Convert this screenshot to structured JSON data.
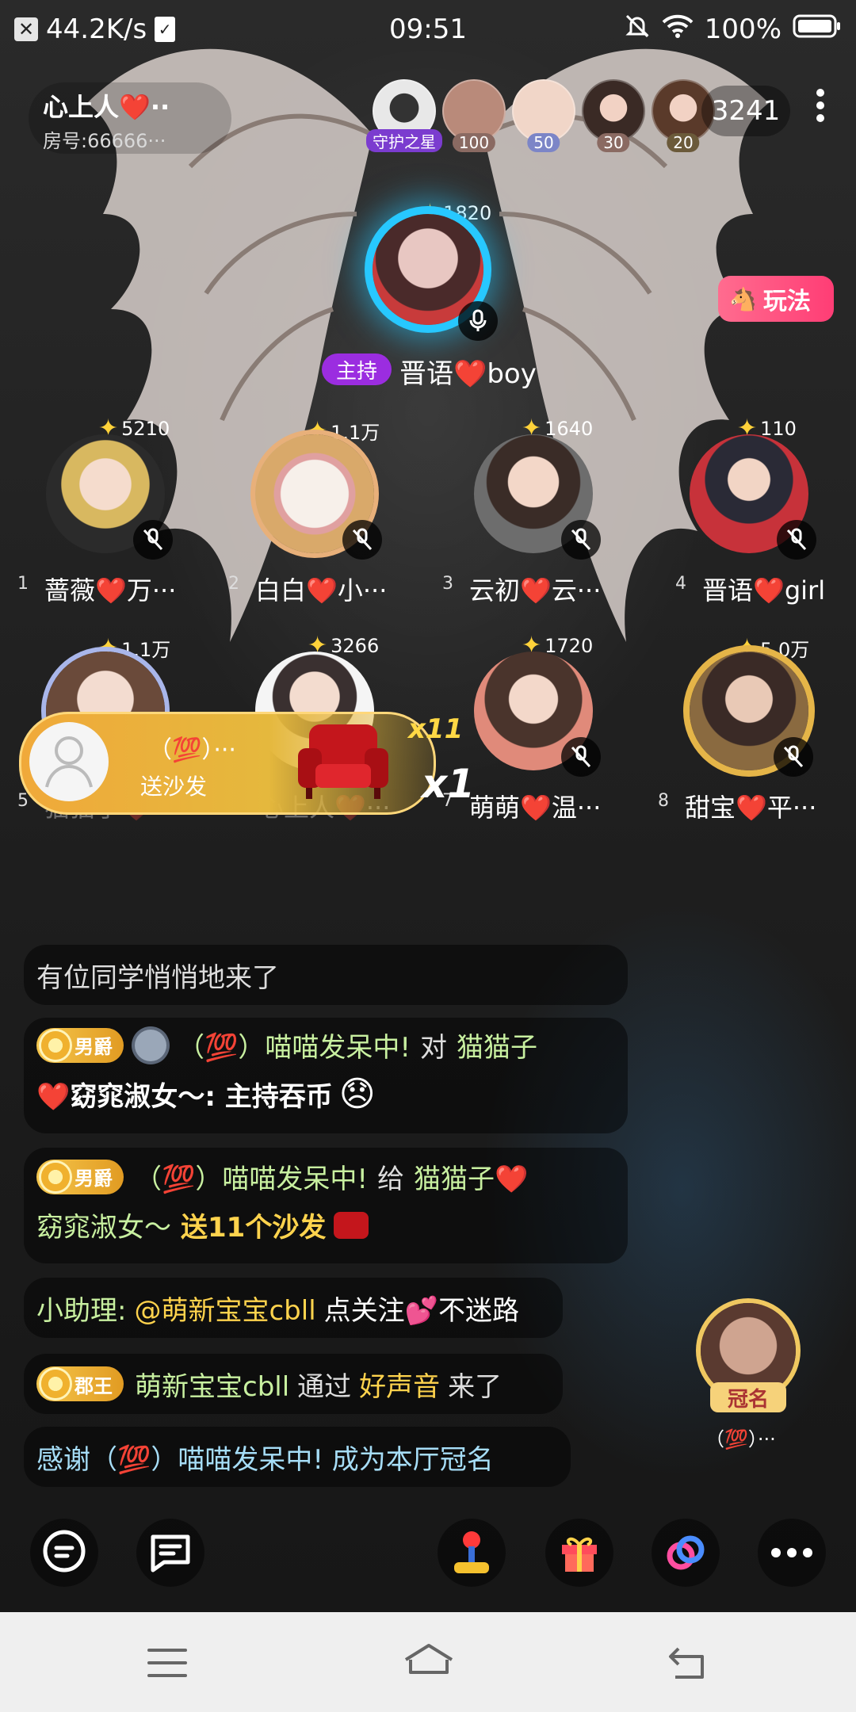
{
  "status_bar": {
    "net_speed": "44.2K/s",
    "time": "09:51",
    "battery": "100%"
  },
  "room": {
    "title": "心上人❤️··",
    "room_id": "房号:66666···"
  },
  "top_avatars": [
    {
      "label": "守护之星"
    },
    {
      "label": "100"
    },
    {
      "label": "50"
    },
    {
      "label": "30"
    },
    {
      "label": "20"
    }
  ],
  "viewer_count": "3241",
  "host": {
    "badge": "主持",
    "name": "晋语❤️boy",
    "score": "1820"
  },
  "play_button": "玩法",
  "seats": [
    {
      "num": "1",
      "name": "蔷薇❤️万···",
      "score": "5210"
    },
    {
      "num": "2",
      "name": "白白❤️小···",
      "score": "1.1万"
    },
    {
      "num": "3",
      "name": "云初❤️云···",
      "score": "1640"
    },
    {
      "num": "4",
      "name": "晋语❤️girl",
      "score": "110"
    },
    {
      "num": "5",
      "name": "猫猫子❤️",
      "score": "1.1万"
    },
    {
      "num": "6",
      "name": "心上人❤️···",
      "score": "3266"
    },
    {
      "num": "7",
      "name": "萌萌❤️温···",
      "score": "1720"
    },
    {
      "num": "8",
      "name": "甜宝❤️平···",
      "score": "5.0万"
    }
  ],
  "gift_banner": {
    "user": "（💯）···",
    "action": "送沙发",
    "count1": "x11",
    "count2": "x1"
  },
  "chat": {
    "m1": "有位同学悄悄地来了",
    "m2_rank": "男爵",
    "m2_user": "（💯）喵喵发呆中!",
    "m2_to": "对",
    "m2_target": "猫猫子",
    "m2_cont": "❤️窈窕淑女～: 主持吞币",
    "m2_emoji": "😞",
    "m3_rank": "男爵",
    "m3_user": "（💯）喵喵发呆中!",
    "m3_give": "给",
    "m3_target": "猫猫子❤️",
    "m3_cont": "窈窕淑女～",
    "m3_gift": "送11个沙发",
    "m4_label": "小助理:",
    "m4_at": "@萌新宝宝cbll",
    "m4_text": "点关注💕不迷路",
    "m5_rank": "郡王",
    "m5_user": "萌新宝宝cbll",
    "m5_via": "通过",
    "m5_src": "好声音",
    "m5_tail": "来了",
    "m6": "感谢（💯）喵喵发呆中! 成为本厅冠名"
  },
  "guanming": {
    "label": "冠名",
    "user": "（💯）···"
  },
  "colors": {
    "accent_cyan": "#27c8ff",
    "host_purple": "#9b2de0",
    "play_pink": "#ff3d75",
    "gift_gold": "#ffd34d"
  }
}
